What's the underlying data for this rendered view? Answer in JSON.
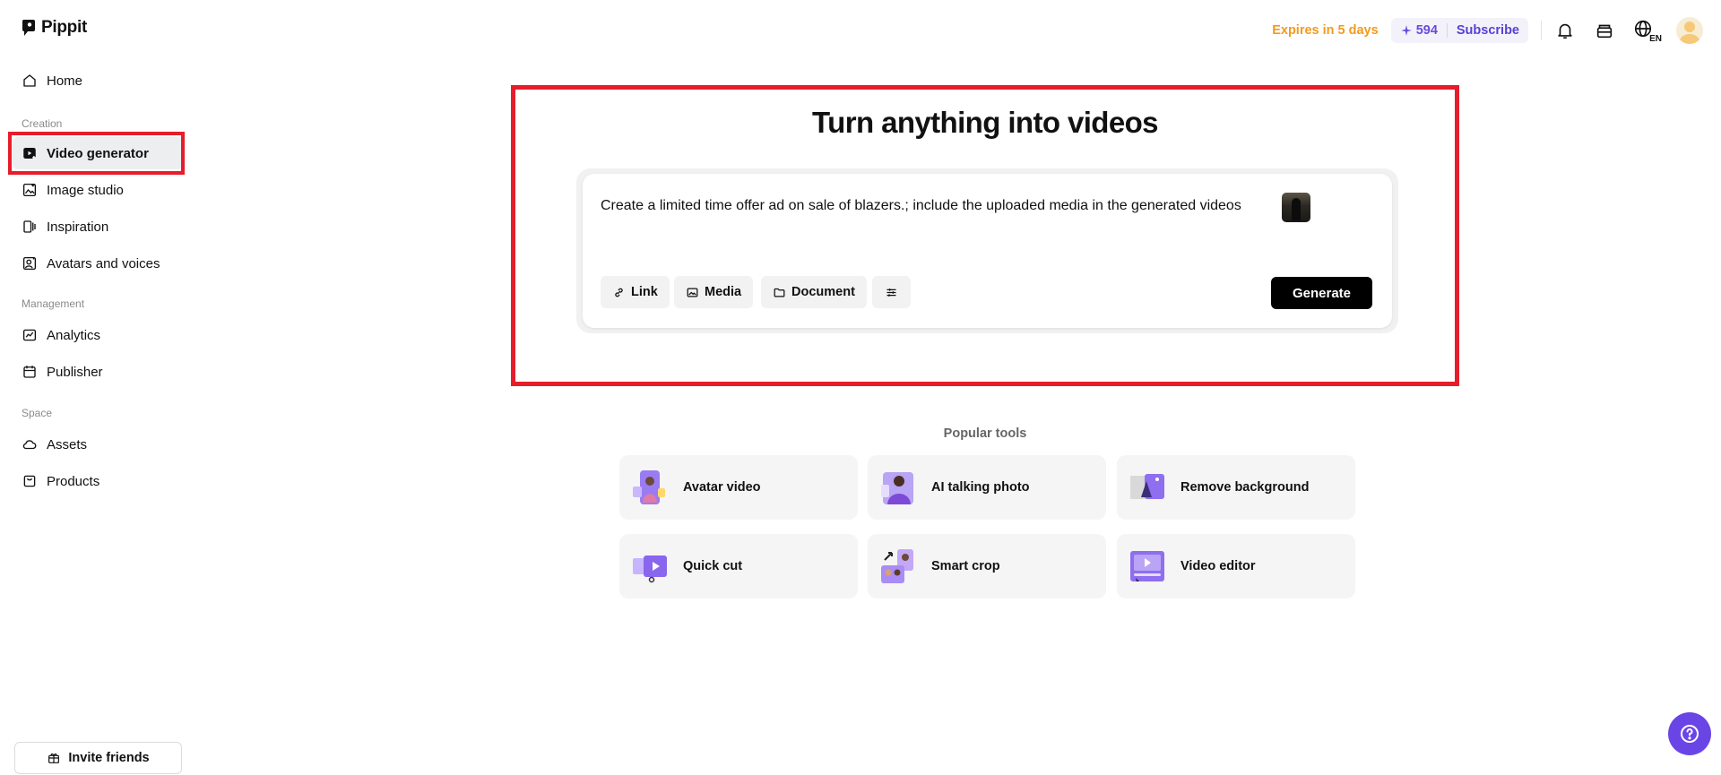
{
  "brand": {
    "name": "Pippit"
  },
  "sidebar": {
    "home": "Home",
    "sections": {
      "creation": "Creation",
      "management": "Management",
      "space": "Space"
    },
    "items": {
      "video_generator": "Video generator",
      "image_studio": "Image studio",
      "inspiration": "Inspiration",
      "avatars_voices": "Avatars and voices",
      "analytics": "Analytics",
      "publisher": "Publisher",
      "assets": "Assets",
      "products": "Products"
    },
    "invite": "Invite friends"
  },
  "topbar": {
    "expires": "Expires in 5 days",
    "credits": "594",
    "subscribe": "Subscribe",
    "language": "EN"
  },
  "hero": {
    "title": "Turn anything into videos",
    "prompt": "Create a limited time offer ad on sale of blazers.; include the uploaded media in the generated videos",
    "chips": {
      "link": "Link",
      "media": "Media",
      "document": "Document"
    },
    "generate": "Generate"
  },
  "popular": {
    "title": "Popular tools",
    "tools": {
      "avatar_video": "Avatar video",
      "ai_talking_photo": "AI talking photo",
      "remove_background": "Remove background",
      "quick_cut": "Quick cut",
      "smart_crop": "Smart crop",
      "video_editor": "Video editor"
    }
  },
  "colors": {
    "accent": "#6a45e6",
    "expires": "#f39a1f",
    "subscribe": "#5b3fd3",
    "highlight": "#e61d2b"
  }
}
